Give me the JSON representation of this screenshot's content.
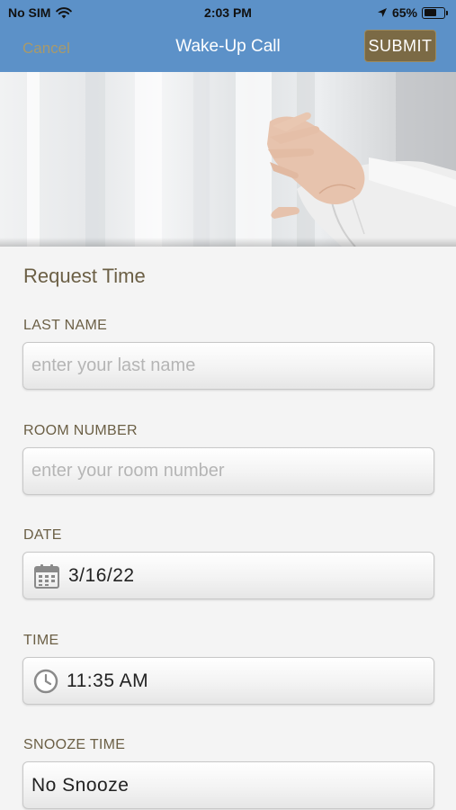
{
  "status_bar": {
    "carrier": "No SIM",
    "time": "2:03 PM",
    "battery_percent": "65%",
    "battery_level": 0.65,
    "icons": [
      "wifi-icon",
      "location-arrow-icon",
      "battery-icon"
    ]
  },
  "nav": {
    "cancel_label": "Cancel",
    "title": "Wake-Up Call",
    "submit_label": "SUBMIT"
  },
  "form": {
    "section_title": "Request Time",
    "last_name": {
      "label": "LAST NAME",
      "placeholder": "enter your last name",
      "value": ""
    },
    "room_number": {
      "label": "ROOM NUMBER",
      "placeholder": "enter your room number",
      "value": ""
    },
    "date": {
      "label": "DATE",
      "value": "3/16/22",
      "icon": "calendar-icon"
    },
    "time": {
      "label": "TIME",
      "value": "11:35 AM",
      "icon": "clock-icon"
    },
    "snooze": {
      "label": "SNOOZE TIME",
      "value": "No Snooze"
    }
  },
  "colors": {
    "header": "#5c91c8",
    "accent_gold": "#7b6a45",
    "label_brown": "#6b5f45",
    "background": "#f4f4f4"
  }
}
